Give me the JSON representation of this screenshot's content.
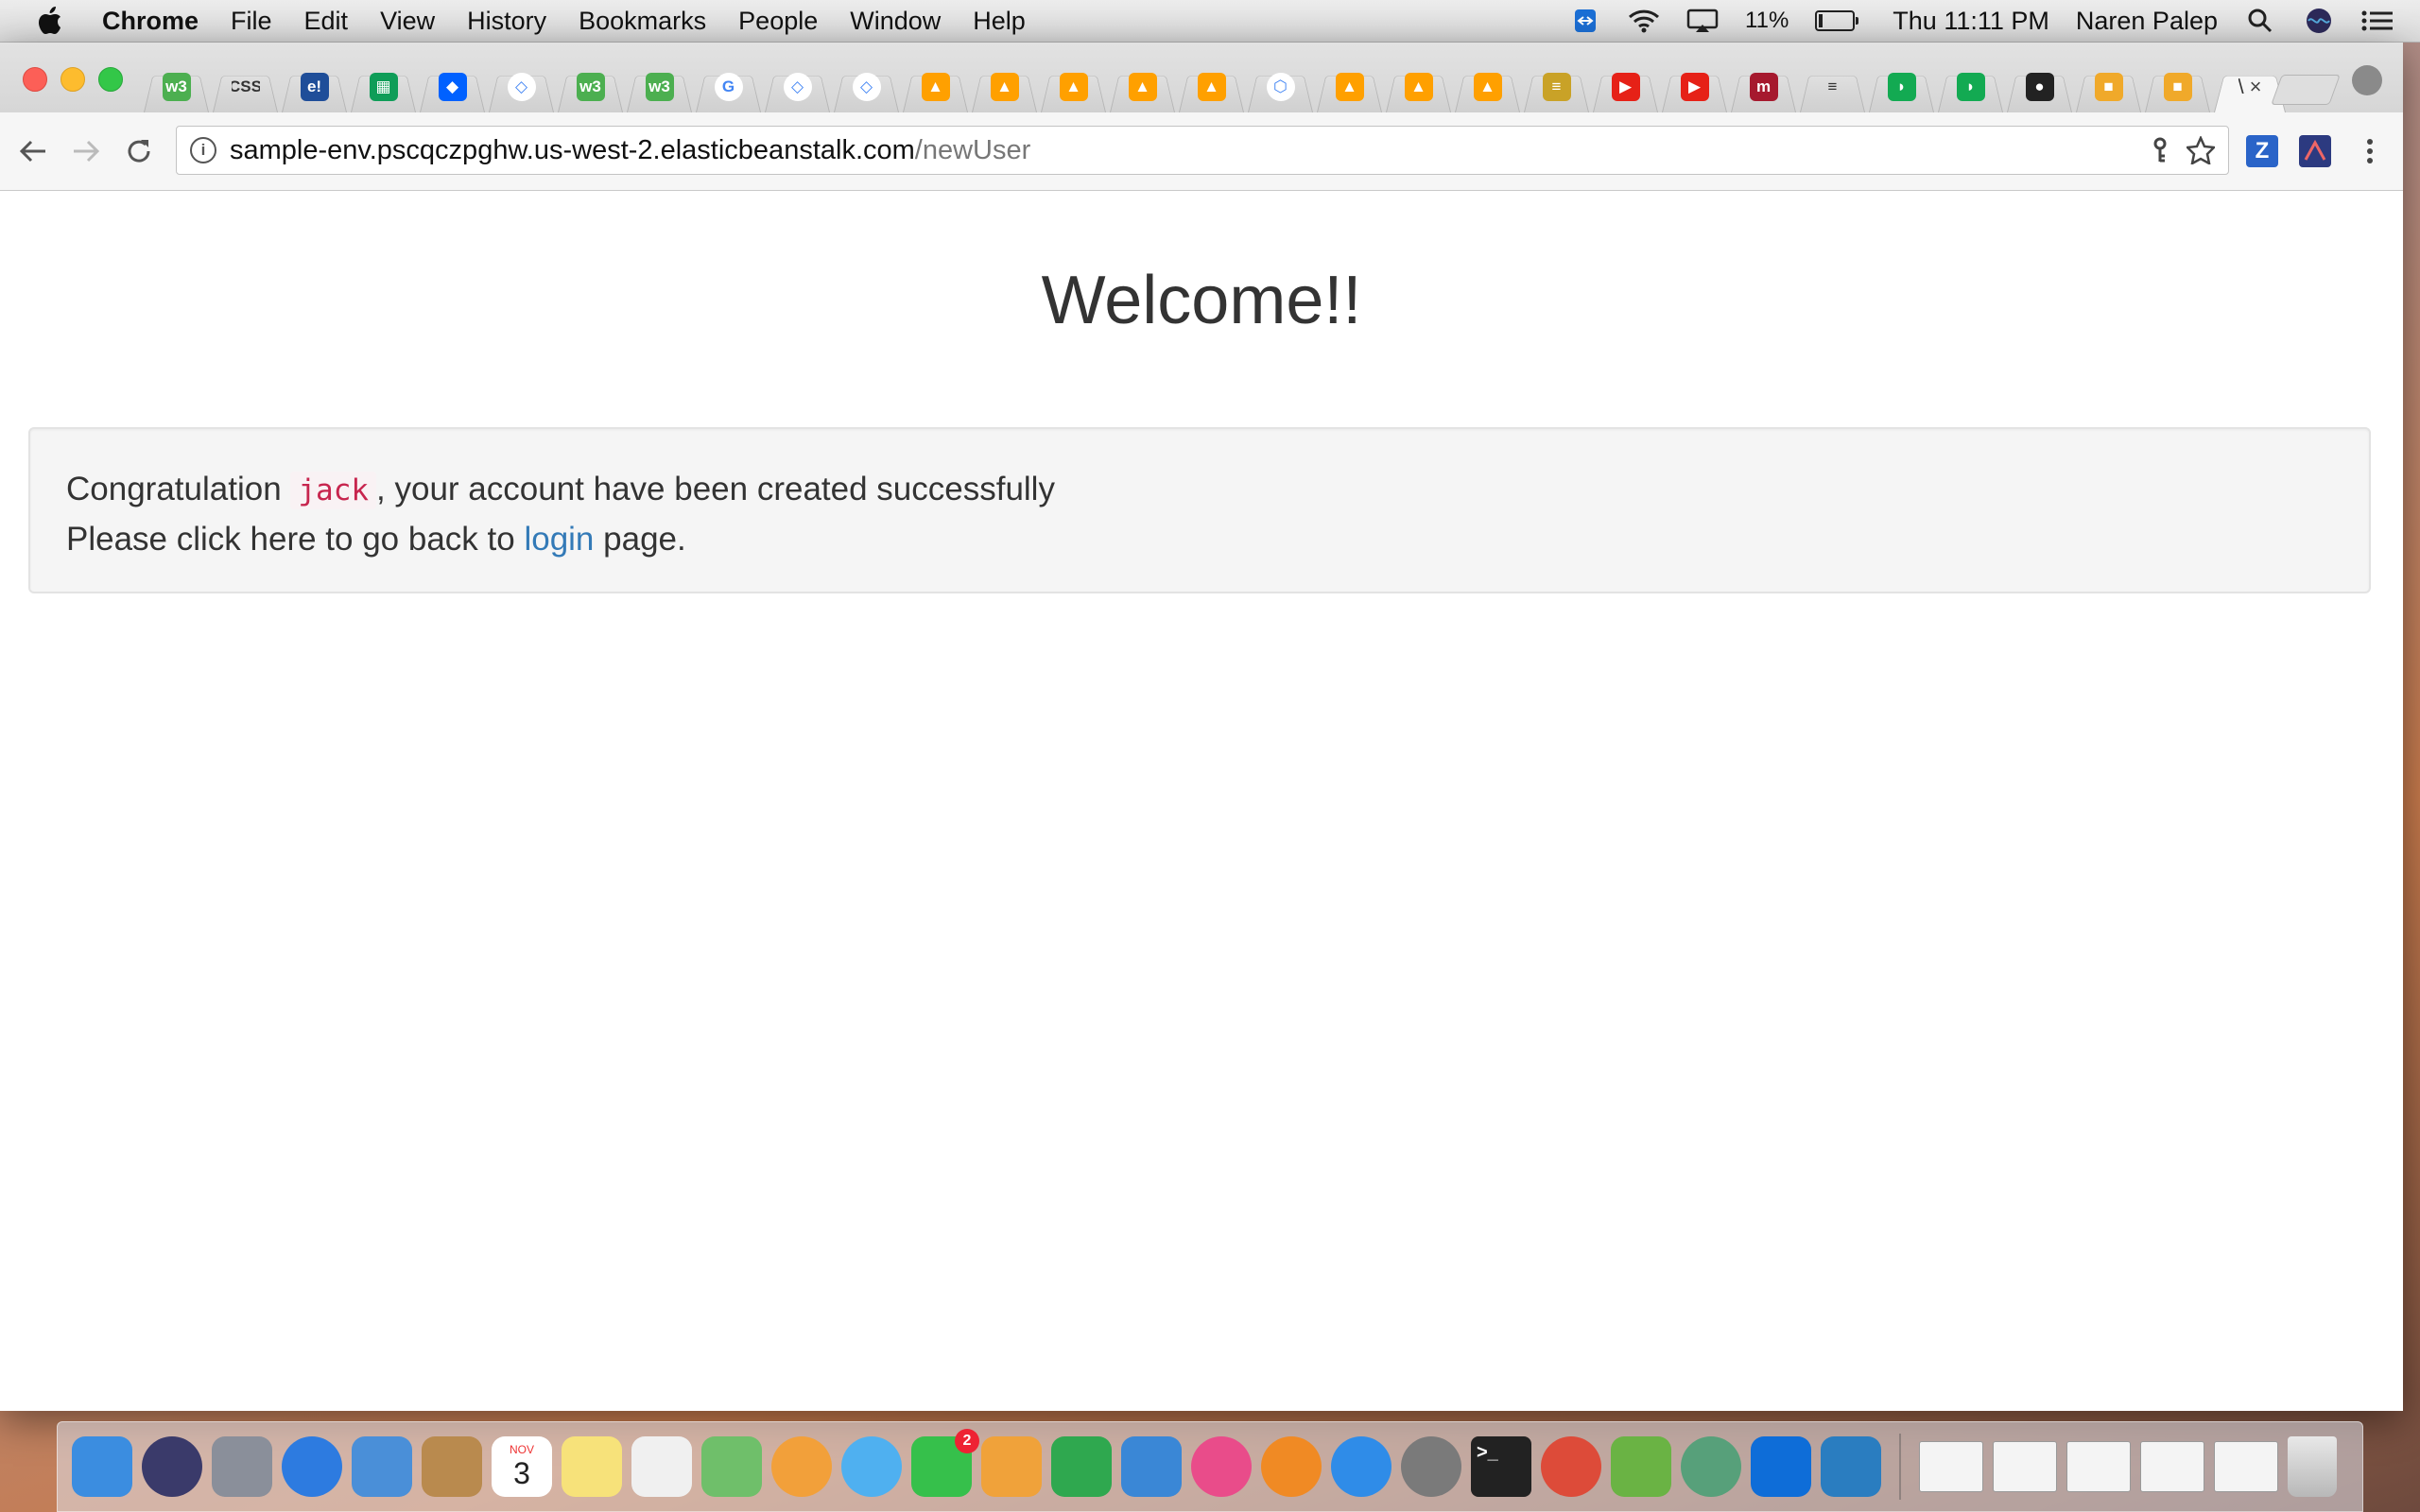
{
  "menubar": {
    "app_name": "Chrome",
    "items": [
      "File",
      "Edit",
      "View",
      "History",
      "Bookmarks",
      "People",
      "Window",
      "Help"
    ],
    "battery": "11%",
    "clock": "Thu 11:11 PM",
    "user": "Naren Palep"
  },
  "tabs": [
    {
      "icon": "w3schools-icon",
      "text": "w3",
      "color": "#4caf50"
    },
    {
      "icon": "css3-icon",
      "text": "CSS",
      "color": "#e0e0e0"
    },
    {
      "icon": "e-icon",
      "text": "e!",
      "color": "#1f4e99"
    },
    {
      "icon": "sheets-icon",
      "text": "▦",
      "color": "#0f9d58"
    },
    {
      "icon": "dropbox-icon",
      "text": "◆",
      "color": "#0061ff"
    },
    {
      "icon": "chrome-webstore-icon",
      "text": "◇",
      "color": "#4285f4"
    },
    {
      "icon": "w3schools-icon",
      "text": "w3",
      "color": "#4caf50"
    },
    {
      "icon": "w3schools-icon",
      "text": "w3",
      "color": "#4caf50"
    },
    {
      "icon": "google-icon",
      "text": "G",
      "color": "#4285f4"
    },
    {
      "icon": "chrome-webstore-icon",
      "text": "◇",
      "color": "#4285f4"
    },
    {
      "icon": "chrome-webstore-icon",
      "text": "◇",
      "color": "#4285f4"
    },
    {
      "icon": "firebase-icon",
      "text": "▲",
      "color": "#ffa000"
    },
    {
      "icon": "firebase-icon",
      "text": "▲",
      "color": "#ffa000"
    },
    {
      "icon": "firebase-icon",
      "text": "▲",
      "color": "#ffa000"
    },
    {
      "icon": "firebase-icon",
      "text": "▲",
      "color": "#ffa000"
    },
    {
      "icon": "firebase-icon",
      "text": "▲",
      "color": "#ffa000"
    },
    {
      "icon": "gcp-icon",
      "text": "⬡",
      "color": "#4285f4"
    },
    {
      "icon": "firebase-icon",
      "text": "▲",
      "color": "#ffa000"
    },
    {
      "icon": "firebase-icon",
      "text": "▲",
      "color": "#ffa000"
    },
    {
      "icon": "firebase-icon",
      "text": "▲",
      "color": "#ffa000"
    },
    {
      "icon": "database-icon",
      "text": "≡",
      "color": "#c9a227"
    },
    {
      "icon": "youtube-icon",
      "text": "▶",
      "color": "#e62117"
    },
    {
      "icon": "youtube-icon",
      "text": "▶",
      "color": "#e62117"
    },
    {
      "icon": "m-icon",
      "text": "m",
      "color": "#a6192e"
    },
    {
      "icon": "generic-icon",
      "text": "≡",
      "color": "#bdbdbd"
    },
    {
      "icon": "mongodb-icon",
      "text": "◗",
      "color": "#13aa52"
    },
    {
      "icon": "mongodb-icon",
      "text": "◗",
      "color": "#13aa52"
    },
    {
      "icon": "github-icon",
      "text": "●",
      "color": "#222222"
    },
    {
      "icon": "aws-box-icon",
      "text": "■",
      "color": "#f0a92a"
    },
    {
      "icon": "aws-box-icon",
      "text": "■",
      "color": "#f0a92a"
    }
  ],
  "active_tab": {
    "title": "\\",
    "close": "×"
  },
  "omnibox": {
    "host": "sample-env.pscqczpghw.us-west-2.elasticbeanstalk.com",
    "path": "/newUser"
  },
  "page": {
    "heading": "Welcome!!",
    "line1_prefix": "Congratulation",
    "username": "jack",
    "line1_suffix": ", your account have been created successfully",
    "line2_prefix": "Please click here to go back to",
    "login_link": "login",
    "line2_suffix": "page."
  },
  "dock": {
    "apps": [
      {
        "name": "finder-icon",
        "color": "#3b8de0"
      },
      {
        "name": "siri-icon",
        "color": "#3a3a6a"
      },
      {
        "name": "launchpad-icon",
        "color": "#8a8f9a"
      },
      {
        "name": "safari-icon",
        "color": "#2d7be0"
      },
      {
        "name": "mail-icon",
        "color": "#4a8fd8"
      },
      {
        "name": "contacts-icon",
        "color": "#b98a4e"
      },
      {
        "name": "calendar-icon",
        "color": "#ffffff"
      },
      {
        "name": "notes-icon",
        "color": "#f7e27a"
      },
      {
        "name": "reminders-icon",
        "color": "#f0f0f0"
      },
      {
        "name": "maps-icon",
        "color": "#6fbf6a"
      },
      {
        "name": "photos-icon",
        "color": "#f2a03a"
      },
      {
        "name": "messages-icon",
        "color": "#4fb0f0"
      },
      {
        "name": "facetime-icon",
        "color": "#36c04b"
      },
      {
        "name": "pages-icon",
        "color": "#f0a23a"
      },
      {
        "name": "numbers-icon",
        "color": "#2fa84f"
      },
      {
        "name": "keynote-icon",
        "color": "#3a87d6"
      },
      {
        "name": "itunes-icon",
        "color": "#e94c8a"
      },
      {
        "name": "ibooks-icon",
        "color": "#f08a24"
      },
      {
        "name": "app-store-icon",
        "color": "#2f8ce8"
      },
      {
        "name": "system-preferences-icon",
        "color": "#7a7a7a"
      },
      {
        "name": "terminal-icon",
        "color": "#222222"
      },
      {
        "name": "chrome-icon",
        "color": "#dd4b39"
      },
      {
        "name": "android-studio-icon",
        "color": "#6ab344"
      },
      {
        "name": "atom-icon",
        "color": "#57a07a"
      },
      {
        "name": "teamviewer-icon",
        "color": "#0e6dd8"
      },
      {
        "name": "brackets-icon",
        "color": "#2a7dc0"
      }
    ],
    "calendar_month": "NOV",
    "calendar_day": "3",
    "facetime_badge": "2"
  }
}
